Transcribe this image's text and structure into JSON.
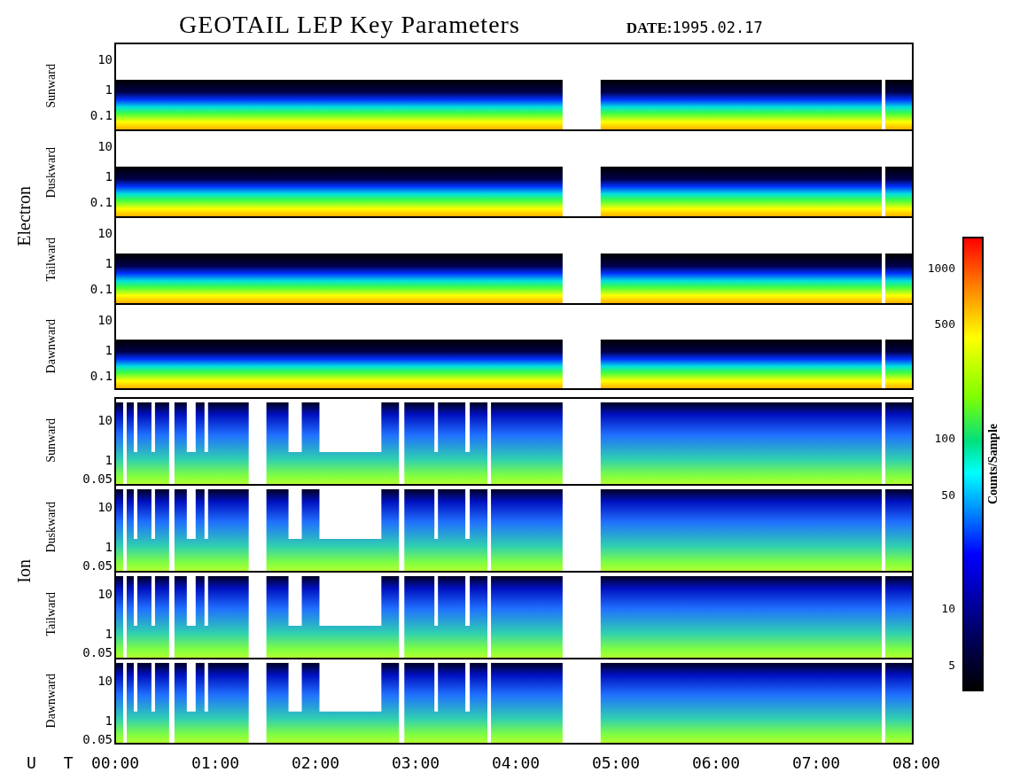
{
  "title": "GEOTAIL LEP Key Parameters",
  "date": "**DATE:**1995.02.17",
  "groups": [
    {
      "label": "Electron",
      "panels": [
        {
          "label": "Sunward",
          "kind": "electron",
          "yticks": [
            "10",
            "1",
            "0.1"
          ]
        },
        {
          "label": "Duskward",
          "kind": "electron",
          "yticks": [
            "10",
            "1",
            "0.1"
          ]
        },
        {
          "label": "Tailward",
          "kind": "electron",
          "yticks": [
            "10",
            "1",
            "0.1"
          ]
        },
        {
          "label": "Dawnward",
          "kind": "electron",
          "yticks": [
            "10",
            "1",
            "0.1"
          ]
        }
      ]
    },
    {
      "label": "Ion",
      "panels": [
        {
          "label": "Sunward",
          "kind": "ion",
          "yticks": [
            "10",
            "1",
            "0.05"
          ]
        },
        {
          "label": "Duskward",
          "kind": "ion",
          "yticks": [
            "10",
            "1",
            "0.05"
          ]
        },
        {
          "label": "Tailward",
          "kind": "ion",
          "yticks": [
            "10",
            "1",
            "0.05"
          ]
        },
        {
          "label": "Dawnward",
          "kind": "ion",
          "yticks": [
            "10",
            "1",
            "0.05"
          ]
        }
      ]
    }
  ],
  "colorbar": {
    "label": "Counts/Sample",
    "ticks": [
      "1000",
      "500",
      "100",
      "50",
      "10",
      "5"
    ]
  },
  "xaxis": {
    "label": "U T",
    "ticks": [
      "00:00",
      "01:00",
      "02:00",
      "03:00",
      "04:00",
      "05:00",
      "06:00",
      "07:00",
      "08:00"
    ]
  }
}
